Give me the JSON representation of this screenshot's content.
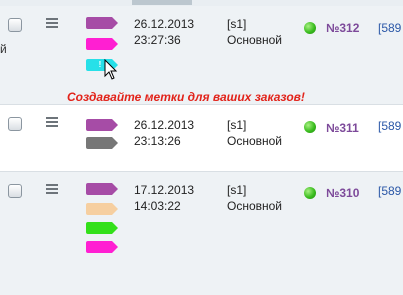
{
  "edge_fragment": "й",
  "banner": "Создавайте метки для ваших заказов!",
  "orders": [
    {
      "date": "26.12.2013",
      "time": "23:27:36",
      "site": "[s1]",
      "status": "Основной",
      "status_color": "#3bbd1f",
      "number": "№312",
      "link": "[589",
      "tags": [
        {
          "color": "#a64ca6",
          "type": "tag"
        },
        {
          "color": "#ff1fd2",
          "type": "tag"
        },
        {
          "color": "#27e0e8",
          "type": "info"
        }
      ]
    },
    {
      "date": "26.12.2013",
      "time": "23:13:26",
      "site": "[s1]",
      "status": "Основной",
      "status_color": "#3bbd1f",
      "number": "№311",
      "link": "[589",
      "tags": [
        {
          "color": "#a64ca6",
          "type": "tag"
        },
        {
          "color": "#777777",
          "type": "tag"
        }
      ]
    },
    {
      "date": "17.12.2013",
      "time": "14:03:22",
      "site": "[s1]",
      "status": "Основной",
      "status_color": "#3bbd1f",
      "number": "№310",
      "link": "[589",
      "tags": [
        {
          "color": "#a64ca6",
          "type": "tag"
        },
        {
          "color": "#f6cfa0",
          "type": "tag"
        },
        {
          "color": "#33e01a",
          "type": "tag"
        },
        {
          "color": "#ff1fd2",
          "type": "tag"
        }
      ]
    }
  ]
}
